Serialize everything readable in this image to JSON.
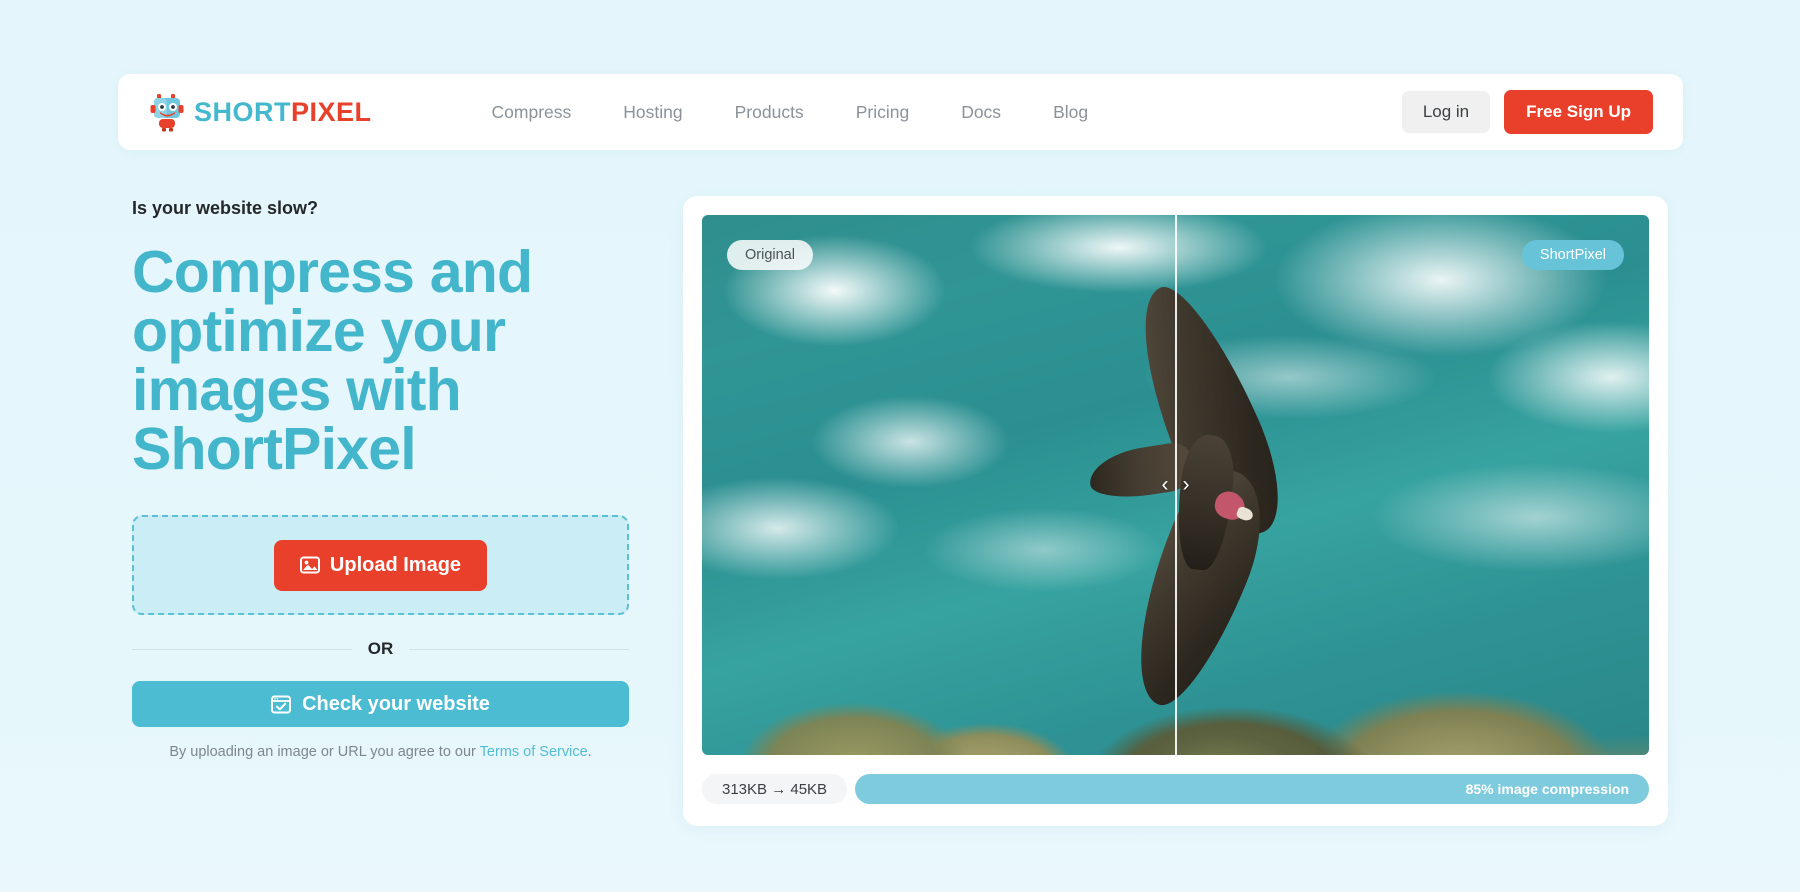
{
  "brand": {
    "short": "SHORT",
    "pixel": "PIXEL",
    "logo_icon": "robot-mascot-icon"
  },
  "nav": {
    "links": [
      {
        "label": "Compress"
      },
      {
        "label": "Hosting"
      },
      {
        "label": "Products"
      },
      {
        "label": "Pricing"
      },
      {
        "label": "Docs"
      },
      {
        "label": "Blog"
      }
    ],
    "login_label": "Log in",
    "signup_label": "Free Sign Up"
  },
  "hero": {
    "eyebrow": "Is your website slow?",
    "headline_line1": "Compress and",
    "headline_line2": "optimize your",
    "headline_line3": "images with",
    "headline_line4": "ShortPixel",
    "upload_label": "Upload Image",
    "upload_icon": "image-icon",
    "or_label": "OR",
    "check_label": "Check your website",
    "check_icon": "browser-check-icon",
    "terms_prefix": "By uploading an image or URL you agree to our ",
    "terms_link": "Terms of Service",
    "terms_suffix": "."
  },
  "comparison": {
    "badge_original": "Original",
    "badge_optimized": "ShortPixel",
    "handle_left_icon": "chevron-left-icon",
    "handle_right_icon": "chevron-right-icon",
    "size_text": "313KB → 45KB",
    "compression_text": "85% image compression",
    "original_size": "313KB",
    "optimized_size": "45KB",
    "compression_percent": 85
  },
  "colors": {
    "page_background": "#e4f6fc",
    "brand_teal": "#44b8cd",
    "brand_red": "#e8402a",
    "accent_bar": "#7ecbdd",
    "text_dark": "#24282b",
    "text_muted": "#8b9399"
  }
}
